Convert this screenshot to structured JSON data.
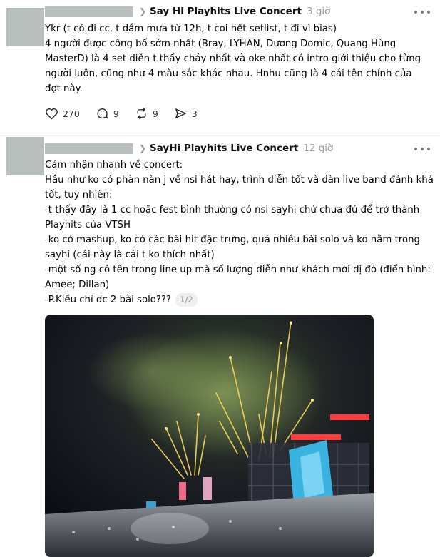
{
  "posts": [
    {
      "topic": "Say Hi Playhits Live Concert",
      "time": "3 giờ",
      "lines": [
        "Ykr (t có đi cc, t dầm mưa từ 12h, t coi hết setlist, t đi vì bias)",
        "4 người được công bố sớm nhất (Bray, LYHAN, Dương Domic, Quang Hùng",
        "MasterD) là 4 set diễn t thấy cháy nhất và oke nhất có intro giới thiệu cho từng",
        "người luôn, cũng như 4 màu sắc khác nhau. Hnhu cũng là 4 cái tên chính của",
        "đợt này."
      ],
      "likes": "270",
      "comments": "9",
      "reposts": "9",
      "shares": "3"
    },
    {
      "topic": "SayHi Playhits Live Concert",
      "time": "12 giờ",
      "lines": [
        "Cảm nhận nhanh về concert:",
        "Hầu như ko có phàn nàn j về nsi hát hay, trình diễn tốt và dàn live band đánh khá",
        "tốt, tuy nhiên:",
        "-t thấy đây là 1 cc hoặc fest bình thường có nsi sayhi chứ chưa đủ để trở thành",
        "Playhits của VTSH",
        "-ko có mashup, ko có các bài hit đặc trưng, quá nhiều bài solo và ko nằm trong",
        "sayhi (cái này là cái t ko thích nhất)",
        "-một số ng có tên trong line up mà số lượng diễn như khách mời dị đó (điển hình:",
        "Amee; Dillan)",
        "-P.Kiều chỉ dc 2 bài solo???"
      ],
      "pager": "1/2"
    }
  ],
  "icons": {
    "like": "heart-icon",
    "comment": "comment-icon",
    "repost": "repost-icon",
    "share": "share-icon",
    "more": "more-icon",
    "chevron": "chevron-right-icon"
  }
}
